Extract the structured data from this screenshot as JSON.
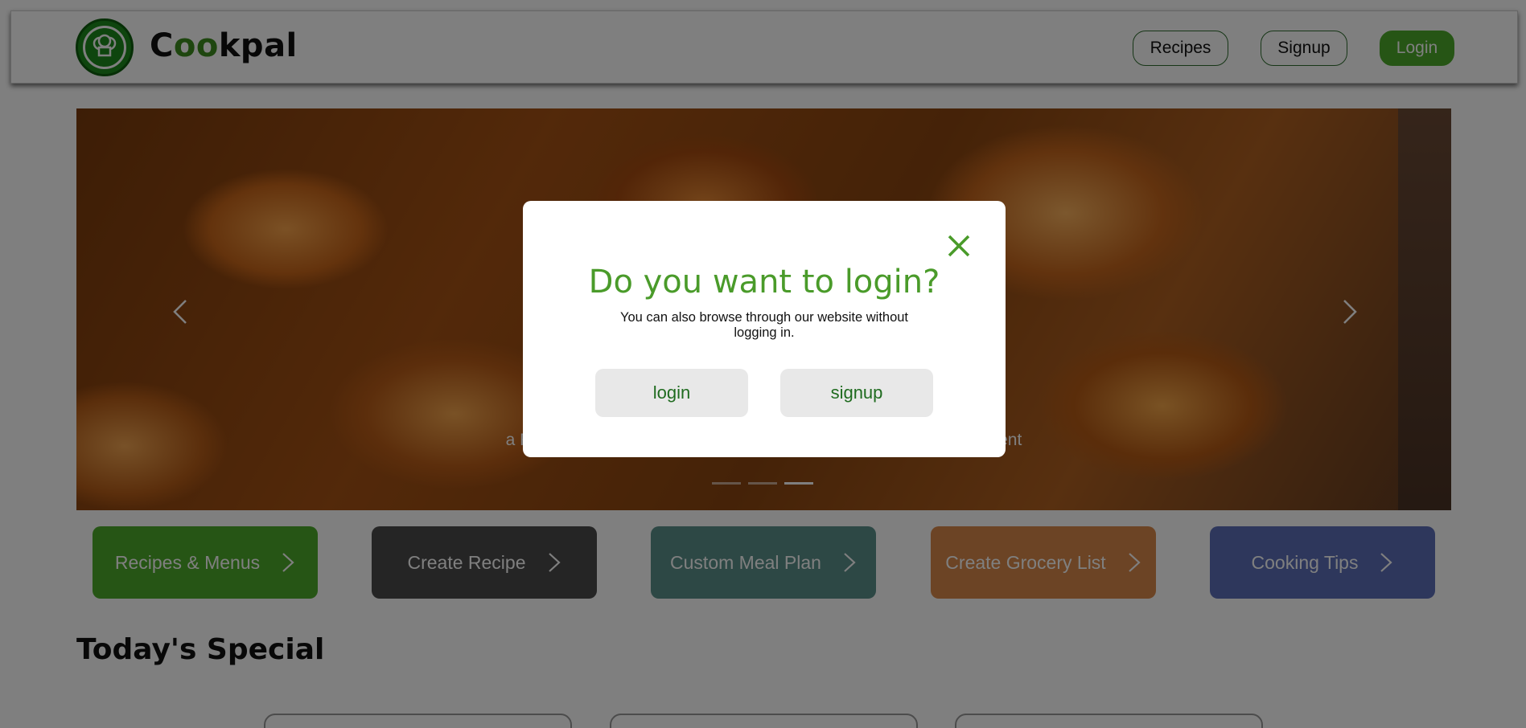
{
  "brand": {
    "prefix": "C",
    "middle": "oo",
    "suffix": "kpal"
  },
  "nav": {
    "recipes_label": "Recipes",
    "signup_label": "Signup",
    "login_label": "Login"
  },
  "hero": {
    "caption": "a French pastry made of puff pastry dough in the shape of a crescent",
    "slides_total": 3,
    "active_slide": 3
  },
  "categories": [
    {
      "label": "Recipes & Menus",
      "color": "#4caa2a"
    },
    {
      "label": "Create Recipe",
      "color": "#4a4a4a"
    },
    {
      "label": "Custom Meal Plan",
      "color": "#5a908a"
    },
    {
      "label": "Create Grocery List",
      "color": "#d9884a"
    },
    {
      "label": "Cooking Tips",
      "color": "#5c6fb8"
    }
  ],
  "section": {
    "title": "Today's Special"
  },
  "modal": {
    "title": "Do you want to login?",
    "subtitle": "You can also browse through our website without logging in.",
    "login_label": "login",
    "signup_label": "signup"
  },
  "colors": {
    "primary_green": "#4caa2a",
    "title_green": "#4a9b2a"
  }
}
